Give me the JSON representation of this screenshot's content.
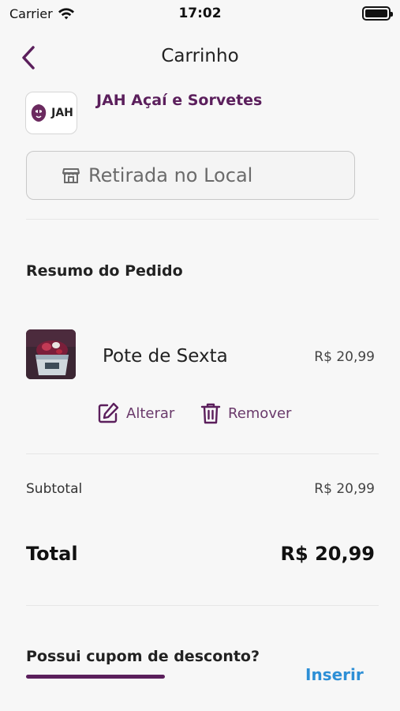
{
  "status_bar": {
    "carrier": "Carrier",
    "time": "17:02",
    "wifi_icon": "wifi-icon",
    "battery_icon": "battery-icon"
  },
  "nav": {
    "title": "Carrinho",
    "back_icon": "chevron-left-icon"
  },
  "store": {
    "logo_text": "JAH",
    "name": "JAH Açaí e Sorvetes"
  },
  "pickup": {
    "icon": "store-icon",
    "label": "Retirada no Local"
  },
  "order_summary": {
    "title": "Resumo do Pedido",
    "items": [
      {
        "name": "Pote de Sexta",
        "price": "R$ 20,99",
        "edit_label": "Alterar",
        "remove_label": "Remover"
      }
    ]
  },
  "totals": {
    "subtotal_label": "Subtotal",
    "subtotal_value": "R$ 20,99",
    "total_label": "Total",
    "total_value": "R$ 20,99"
  },
  "coupon": {
    "title": "Possui cupom de desconto?",
    "insert_label": "Inserir"
  },
  "colors": {
    "brand": "#5b1f5c",
    "link": "#2d8fd6",
    "background": "#f7f7f7"
  }
}
